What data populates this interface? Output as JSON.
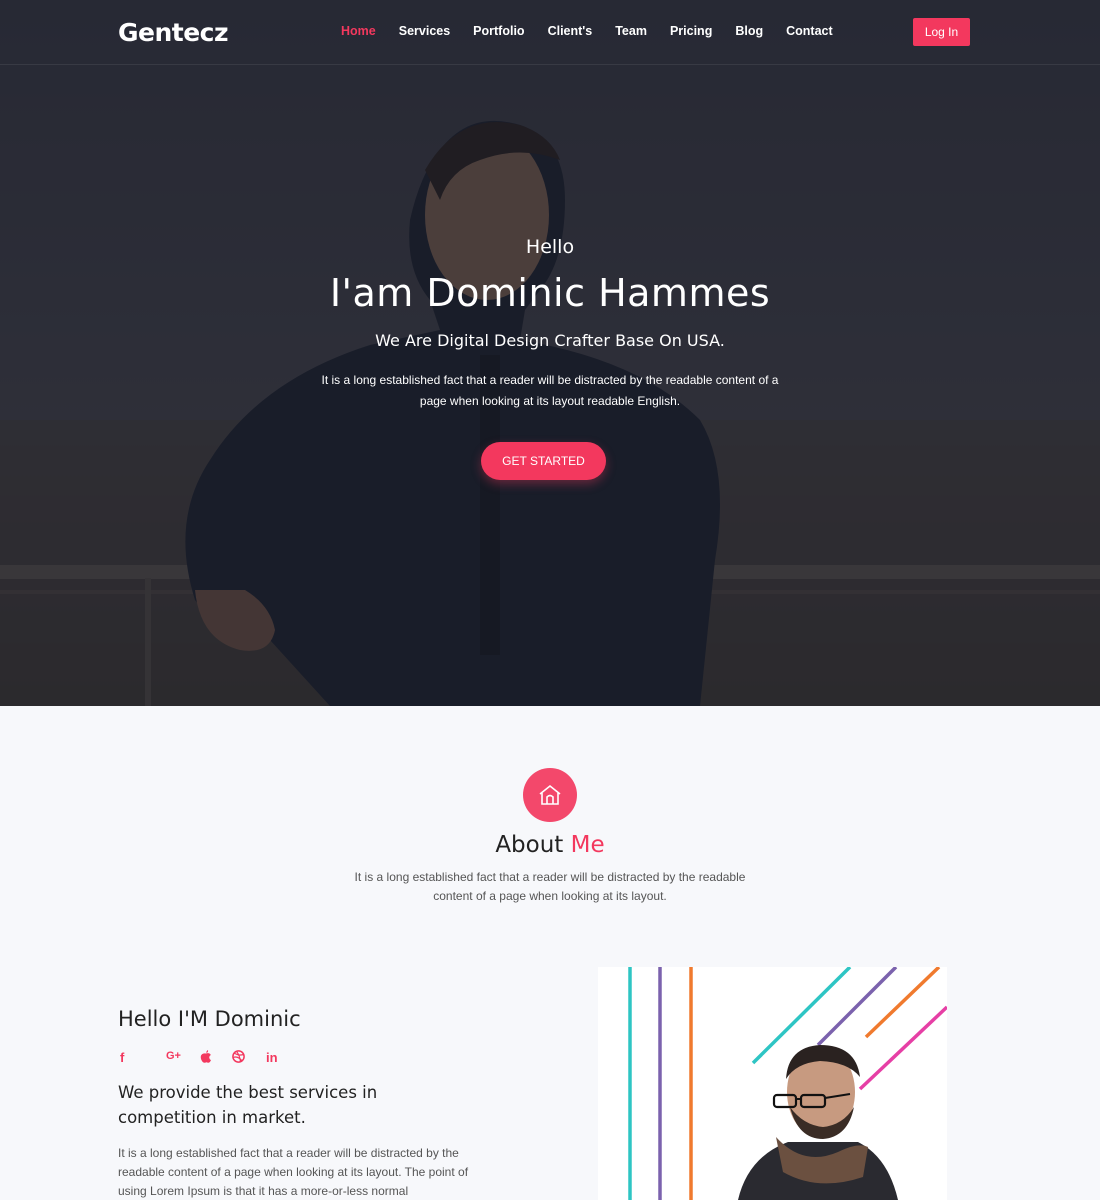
{
  "nav": {
    "logo": "Gentecz",
    "links": [
      "Home",
      "Services",
      "Portfolio",
      "Client's",
      "Team",
      "Pricing",
      "Blog",
      "Contact"
    ],
    "login": "Log In"
  },
  "hero": {
    "greeting": "Hello",
    "name": "I'am Dominic Hammes",
    "tagline": "We Are Digital Design Crafter Base On USA.",
    "description": "It is a long established fact that a reader will be distracted by the readable content of a page when looking at its layout readable English.",
    "cta": "GET STARTED"
  },
  "about": {
    "title_main": "About",
    "title_accent": "Me",
    "description": "It is a long established fact that a reader will be distracted by the readable content of a page when looking at its layout.",
    "heading": "Hello I'M Dominic",
    "socials": [
      "f",
      "G+",
      "",
      "",
      "in"
    ],
    "subheading": "We provide the best services in competition in market.",
    "body": "It is a long established fact that a reader will be distracted by the readable content of a page when looking at its layout. The point of using Lorem Ipsum is that it has a more-or-less normal"
  },
  "colors": {
    "accent": "#f3385e",
    "dark": "#24252f"
  }
}
